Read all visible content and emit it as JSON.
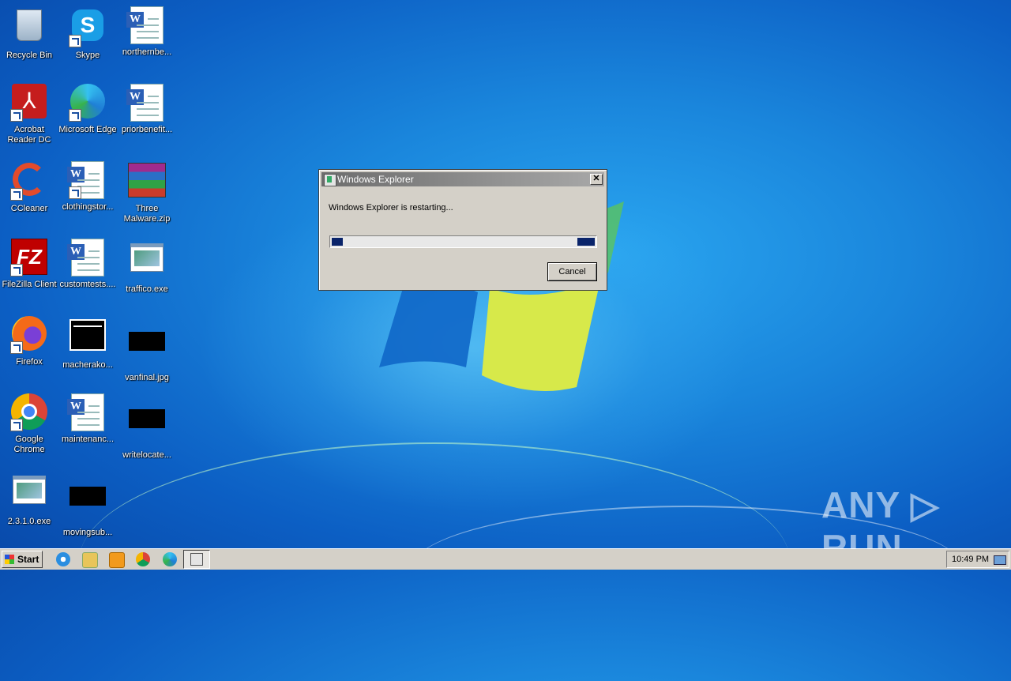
{
  "desktop": {
    "icons": [
      {
        "label": "Recycle Bin",
        "icon": "recycle-bin-icon"
      },
      {
        "label": "Skype",
        "icon": "skype-icon"
      },
      {
        "label": "northernbe...",
        "icon": "word-document-icon"
      },
      {
        "label": "Acrobat Reader DC",
        "icon": "acrobat-icon"
      },
      {
        "label": "Microsoft Edge",
        "icon": "edge-icon"
      },
      {
        "label": "priorbenefit...",
        "icon": "word-document-icon"
      },
      {
        "label": "CCleaner",
        "icon": "ccleaner-icon"
      },
      {
        "label": "clothingstor...",
        "icon": "word-document-icon"
      },
      {
        "label": "Three Malware.zip",
        "icon": "winrar-archive-icon"
      },
      {
        "label": "FileZilla Client",
        "icon": "filezilla-icon"
      },
      {
        "label": "customtests....",
        "icon": "word-document-icon"
      },
      {
        "label": "traffico.exe",
        "icon": "exe-icon"
      },
      {
        "label": "Firefox",
        "icon": "firefox-icon"
      },
      {
        "label": "macherako...",
        "icon": "window-icon"
      },
      {
        "label": "vanfinal.jpg",
        "icon": "image-icon"
      },
      {
        "label": "Google Chrome",
        "icon": "chrome-icon"
      },
      {
        "label": "maintenanc...",
        "icon": "word-document-icon"
      },
      {
        "label": "writelocate...",
        "icon": "image-icon"
      },
      {
        "label": "2.3.1.0.exe",
        "icon": "exe-icon"
      },
      {
        "label": "movingsub...",
        "icon": "image-icon"
      }
    ]
  },
  "dialog": {
    "title": "Windows Explorer",
    "message": "Windows Explorer is restarting...",
    "cancel_label": "Cancel",
    "close_glyph": "✕"
  },
  "taskbar": {
    "start_label": "Start",
    "clock": "10:49 PM",
    "pinned": [
      "internet-explorer-icon",
      "file-explorer-icon",
      "media-player-icon",
      "chrome-icon",
      "edge-icon",
      "windows-explorer-task-icon"
    ]
  },
  "watermark": "ANY ▷ RUN",
  "colors": {
    "progress_block": "#0a246a",
    "dialog_bg": "#d4d0c8",
    "desktop_blue": "#1a86dc"
  }
}
